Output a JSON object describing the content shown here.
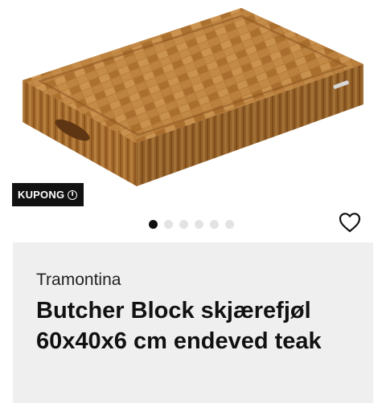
{
  "product": {
    "image_alt": "Tramontina end grain teak butcher block cutting board",
    "coupon_label": "KUPONG",
    "coupon_info_glyph": "i",
    "carousel": {
      "total": 6,
      "active_index": 0
    },
    "brand": "Tramontina",
    "title": "Butcher Block skjærefjøl 60x40x6 cm endeved teak"
  },
  "colors": {
    "coupon_bg": "#111111",
    "card_bg": "#efefef",
    "dot_active": "#111111",
    "dot_inactive": "#e3e3e3"
  },
  "icons": {
    "favorite": "heart-outline-icon",
    "coupon_info": "info-circle-icon"
  }
}
